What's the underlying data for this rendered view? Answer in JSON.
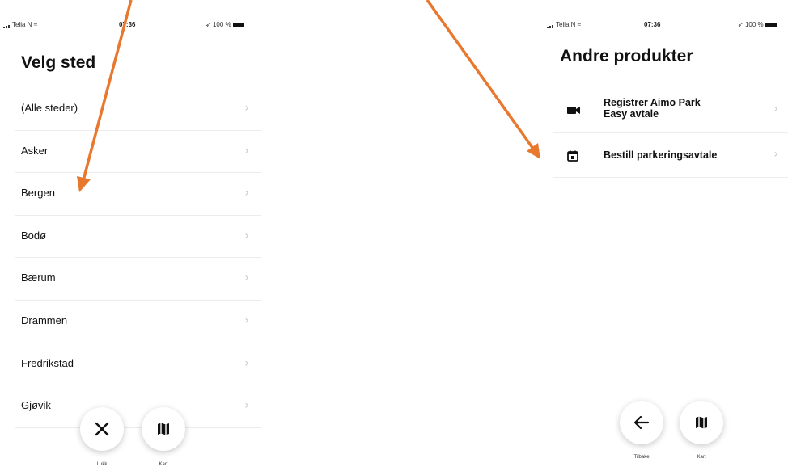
{
  "left_screen": {
    "status": {
      "carrier": "Telia N",
      "time": "07:36",
      "battery": "100 %"
    },
    "title": "Velg sted",
    "locations": [
      "(Alle steder)",
      "Asker",
      "Bergen",
      "Bodø",
      "Bærum",
      "Drammen",
      "Fredrikstad",
      "Gjøvik"
    ],
    "buttons": [
      {
        "label": "Lukk",
        "icon": "close-icon"
      },
      {
        "label": "Kart",
        "icon": "map-icon"
      }
    ]
  },
  "right_screen": {
    "status": {
      "carrier": "Telia N",
      "time": "07:36",
      "battery": "100 %"
    },
    "title": "Andre produkter",
    "products": [
      {
        "label": "Registrer Aimo Park\nEasy avtale",
        "icon": "video-camera-icon"
      },
      {
        "label": "Bestill parkeringsavtale",
        "icon": "calendar-icon"
      }
    ],
    "buttons": [
      {
        "label": "Tilbake",
        "icon": "back-arrow-icon"
      },
      {
        "label": "Kart",
        "icon": "map-icon"
      }
    ]
  },
  "annotation_color": "#e8782e",
  "chevron": "›"
}
